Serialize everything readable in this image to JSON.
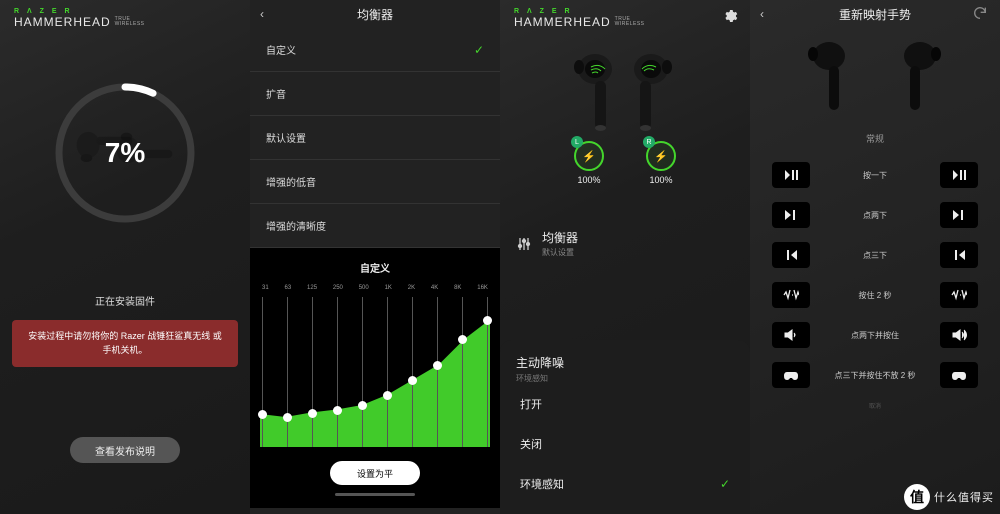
{
  "brand": {
    "name": "R Λ Z E R",
    "product": "HAMMERHEAD",
    "sub1": "TRUE",
    "sub2": "WIRELESS"
  },
  "panel1": {
    "percent": "7%",
    "percent_value": 7,
    "status": "正在安装固件",
    "warning": "安装过程中请勿将你的 Razer 战锤狂鲨真无线 或手机关机。",
    "button": "查看发布说明"
  },
  "panel2": {
    "title": "均衡器",
    "options": [
      {
        "label": "自定义",
        "selected": true
      },
      {
        "label": "扩音",
        "selected": false
      },
      {
        "label": "默认设置",
        "selected": false
      },
      {
        "label": "增强的低音",
        "selected": false
      },
      {
        "label": "增强的清晰度",
        "selected": false
      }
    ],
    "eq_title": "自定义",
    "reset_button": "设置为平"
  },
  "chart_data": {
    "type": "area",
    "title": "自定义",
    "x_labels": [
      "31",
      "63",
      "125",
      "250",
      "500",
      "1K",
      "2K",
      "4K",
      "8K",
      "16K"
    ],
    "values": [
      22,
      20,
      23,
      25,
      28,
      35,
      45,
      55,
      72,
      85
    ],
    "ylim": [
      0,
      100
    ],
    "fill_color": "#44d62c"
  },
  "panel3": {
    "settings_icon": "gear-icon",
    "left": {
      "tag": "L",
      "battery": "100%"
    },
    "right": {
      "tag": "R",
      "battery": "100%"
    },
    "eq_section": {
      "title": "均衡器",
      "subtitle": "默认设置"
    },
    "anc_section": {
      "title": "主动降噪",
      "subtitle": "环境感知",
      "options": [
        {
          "label": "打开",
          "selected": false
        },
        {
          "label": "关闭",
          "selected": false
        },
        {
          "label": "环境感知",
          "selected": true
        }
      ]
    }
  },
  "panel4": {
    "title": "重新映射手势",
    "refresh_icon": "refresh-icon",
    "tab": "常规",
    "rows": [
      {
        "left_icon": "play-pause",
        "label": "按一下",
        "right_icon": "play-pause"
      },
      {
        "left_icon": "next-track",
        "label": "点两下",
        "right_icon": "next-track"
      },
      {
        "left_icon": "prev-track",
        "label": "点三下",
        "right_icon": "prev-track"
      },
      {
        "left_icon": "anc-toggle",
        "label": "按住 2 秒",
        "right_icon": "anc-toggle"
      },
      {
        "left_icon": "vol-down",
        "label": "点两下并按住",
        "right_icon": "vol-up"
      },
      {
        "left_icon": "game-mode",
        "label": "点三下并按住不放 2 秒",
        "right_icon": "game-mode"
      }
    ],
    "footer": "取消"
  },
  "watermark": {
    "glyph": "值",
    "text": "什么值得买"
  }
}
